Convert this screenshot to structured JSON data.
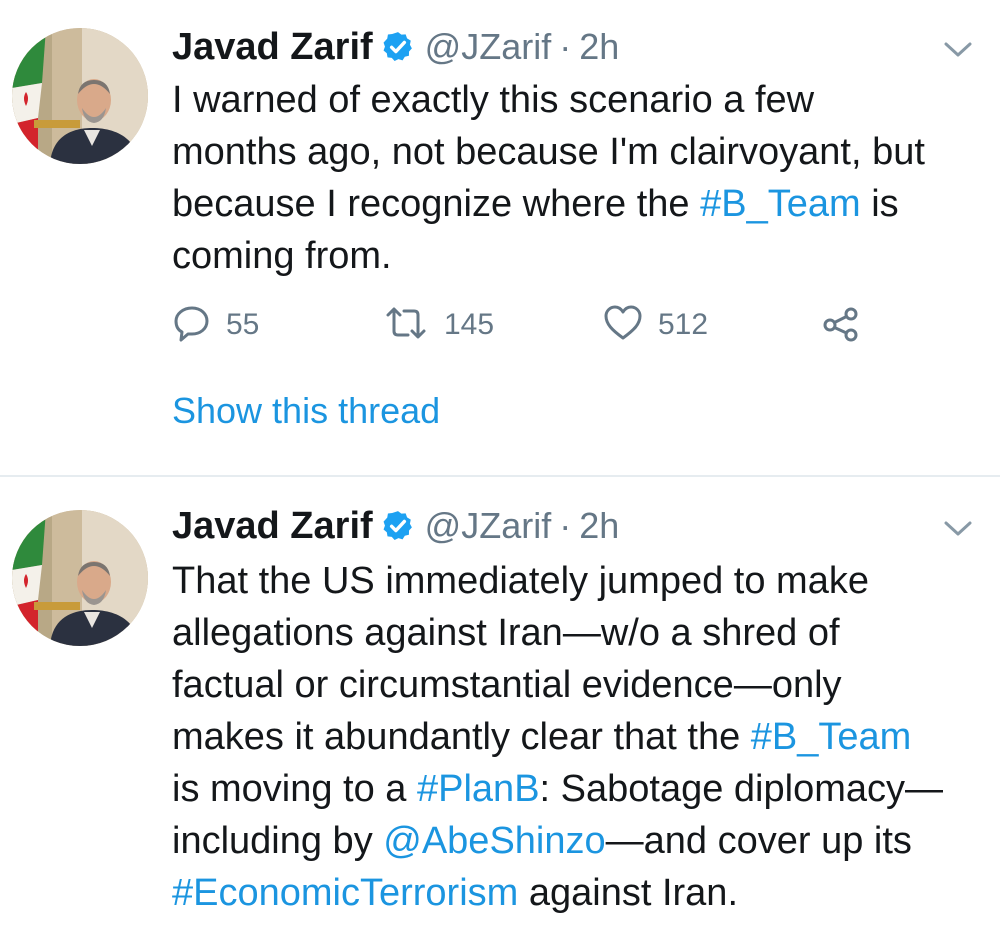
{
  "tweets": [
    {
      "author_name": "Javad Zarif",
      "handle": "@JZarif",
      "separator": "·",
      "time": "2h",
      "lines": [
        [
          {
            "t": "I warned of exactly this scenario a few"
          }
        ],
        [
          {
            "t": "months ago, not because I'm clairvoyant, but"
          }
        ],
        [
          {
            "t": "because I recognize where the "
          },
          {
            "t": "#B_Team",
            "link": true
          },
          {
            "t": " is"
          }
        ],
        [
          {
            "t": "coming from."
          }
        ]
      ],
      "replies": "55",
      "retweets": "145",
      "likes": "512",
      "show_thread": "Show this thread"
    },
    {
      "author_name": "Javad Zarif",
      "handle": "@JZarif",
      "separator": "·",
      "time": "2h",
      "lines": [
        [
          {
            "t": "That the US immediately jumped to make"
          }
        ],
        [
          {
            "t": "allegations against Iran—w/o a shred of"
          }
        ],
        [
          {
            "t": "factual or circumstantial evidence—only"
          }
        ],
        [
          {
            "t": "makes it abundantly clear that the "
          },
          {
            "t": "#B_Team",
            "link": true
          }
        ],
        [
          {
            "t": "is moving to a "
          },
          {
            "t": "#PlanB",
            "link": true
          },
          {
            "t": ": Sabotage diplomacy—"
          }
        ],
        [
          {
            "t": "including by "
          },
          {
            "t": "@AbeShinzo",
            "link": true
          },
          {
            "t": "—and cover up its"
          }
        ],
        [
          {
            "t": "#EconomicTerrorism",
            "link": true
          },
          {
            "t": " against Iran."
          }
        ]
      ]
    }
  ],
  "icons": {
    "verified": "verified-badge-icon",
    "caret": "chevron-down-icon",
    "reply": "reply-icon",
    "retweet": "retweet-icon",
    "like": "heart-icon",
    "share": "share-icon"
  },
  "colors": {
    "link": "#1b95e0",
    "secondary_text": "#657786",
    "primary_text": "#14171a",
    "verified": "#1da1f2",
    "divider": "#e6ecf0"
  }
}
